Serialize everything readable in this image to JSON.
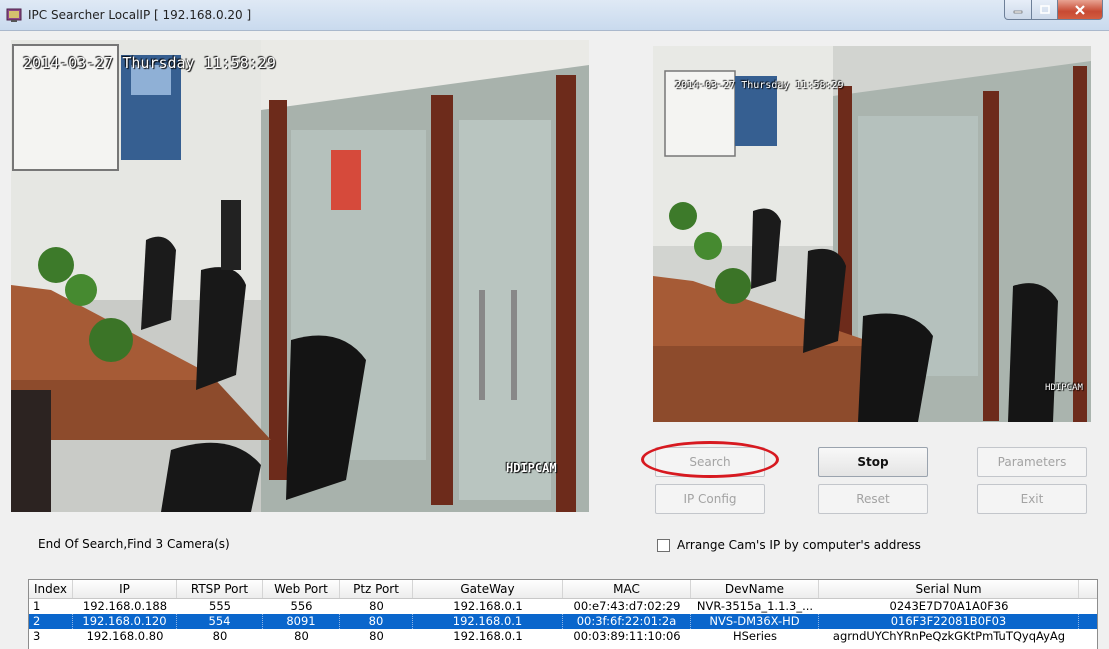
{
  "window": {
    "title": "IPC Searcher LocalIP [ 192.168.0.20 ]"
  },
  "preview": {
    "main_timestamp": "2014-03-27 Thursday 11:58:29",
    "main_camera_label": "HDIPCAM",
    "side_timestamp": "2014-03-27 Thursday 11:58:29",
    "side_camera_label": "HDIPCAM"
  },
  "buttons": {
    "search": "Search",
    "stop": "Stop",
    "parameters": "Parameters",
    "ip_config": "IP Config",
    "reset": "Reset",
    "exit": "Exit"
  },
  "status": {
    "text": "End Of Search,Find 3 Camera(s)"
  },
  "options": {
    "arrange_label": "Arrange Cam's IP by computer's address",
    "arrange_checked": false
  },
  "table": {
    "columns": [
      "Index",
      "IP",
      "RTSP Port",
      "Web Port",
      "Ptz Port",
      "GateWay",
      "MAC",
      "DevName",
      "Serial Num"
    ],
    "rows": [
      [
        "1",
        "192.168.0.188",
        "555",
        "556",
        "80",
        "192.168.0.1",
        "00:e7:43:d7:02:29",
        "NVR-3515a_1.1.3_...",
        "0243E7D70A1A0F36"
      ],
      [
        "2",
        "192.168.0.120",
        "554",
        "8091",
        "80",
        "192.168.0.1",
        "00:3f:6f:22:01:2a",
        "NVS-DM36X-HD",
        "016F3F22081B0F03"
      ],
      [
        "3",
        "192.168.0.80",
        "80",
        "80",
        "80",
        "192.168.0.1",
        "00:03:89:11:10:06",
        "HSeries",
        "agrndUYChYRnPeQzkGKtPmTuTQyqAyAg"
      ]
    ],
    "selected_row": 1
  },
  "colors": {
    "selection": "#0a66cc",
    "highlight_ring": "#d71920"
  }
}
